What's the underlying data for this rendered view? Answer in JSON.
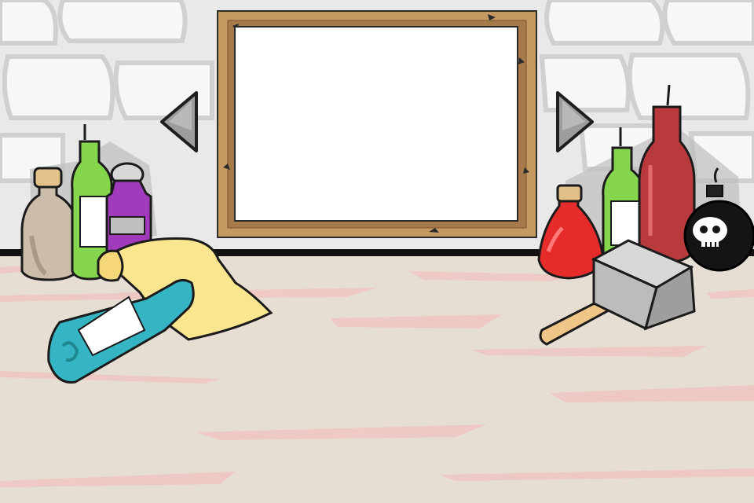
{
  "scene": {
    "colors": {
      "wall": "#eaeaea",
      "wall_brick": "#f6f6f6",
      "wall_mortar": "#c9c9c9",
      "floor": "#e6ddd3",
      "floor_streak": "#efc3bf",
      "frame_wood": "#c6985f",
      "frame_inner": "#a57849",
      "screen": "#ffffff",
      "arrow": "#9a9a9a"
    },
    "frame": {
      "icon": "picture-frame-icon"
    },
    "nav": {
      "prev_icon": "triangle-left-icon",
      "next_icon": "triangle-right-icon"
    },
    "items": [
      {
        "name": "cork-jar",
        "icon": "jar-icon",
        "color": "#c9b9a6"
      },
      {
        "name": "green-bottle-left",
        "icon": "bottle-icon",
        "color": "#7fd04a"
      },
      {
        "name": "purple-bottle",
        "icon": "bottle-icon",
        "color": "#9d36b6"
      },
      {
        "name": "paper-scroll",
        "icon": "scroll-icon",
        "color": "#fbe78f"
      },
      {
        "name": "teal-bottle",
        "icon": "bottle-icon",
        "color": "#2fb2c0"
      },
      {
        "name": "red-flask",
        "icon": "flask-icon",
        "color": "#e52b2b"
      },
      {
        "name": "green-bottle-right",
        "icon": "bottle-icon",
        "color": "#7fd04a"
      },
      {
        "name": "red-bottle",
        "icon": "bottle-icon",
        "color": "#b8383b"
      },
      {
        "name": "skull-bomb",
        "icon": "bomb-icon",
        "color": "#111111"
      },
      {
        "name": "mallet",
        "icon": "hammer-icon",
        "color": "#a9a9a9"
      }
    ]
  }
}
